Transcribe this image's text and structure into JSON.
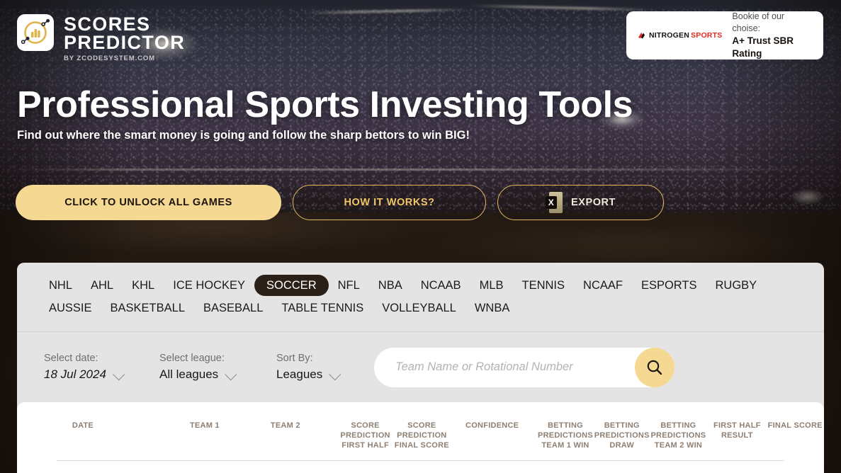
{
  "brand": {
    "line1": "SCORES",
    "line2": "PREDICTOR",
    "tagline": "BY ZCODESYSTEM.COM",
    "logo_icon": "bar-chart-circle-icon",
    "accent": "#f5d892",
    "panel_bg": "#e4e4e4",
    "active_tab_bg": "#2b2018"
  },
  "bookie": {
    "brand_part1": "NITROGEN",
    "brand_part2": "SPORTS",
    "brand_part2_color": "#e8281e",
    "label": "Bookie of our choise:",
    "rating": "A+ Trust SBR Rating"
  },
  "hero": {
    "title": "Professional Sports Investing Tools",
    "subtitle": "Find out where the smart money is going and follow the sharp bettors to win BIG!"
  },
  "cta": {
    "unlock": "CLICK TO UNLOCK ALL GAMES",
    "how_it_works": "HOW IT WORKS?",
    "export": "EXPORT",
    "export_icon": "excel-file-icon",
    "export_icon_letter": "X"
  },
  "tabs": [
    {
      "label": "NHL",
      "active": false
    },
    {
      "label": "AHL",
      "active": false
    },
    {
      "label": "KHL",
      "active": false
    },
    {
      "label": "ICE HOCKEY",
      "active": false
    },
    {
      "label": "SOCCER",
      "active": true
    },
    {
      "label": "NFL",
      "active": false
    },
    {
      "label": "NBA",
      "active": false
    },
    {
      "label": "NCAAB",
      "active": false
    },
    {
      "label": "MLB",
      "active": false
    },
    {
      "label": "TENNIS",
      "active": false
    },
    {
      "label": "NCAAF",
      "active": false
    },
    {
      "label": "ESPORTS",
      "active": false
    },
    {
      "label": "RUGBY",
      "active": false
    },
    {
      "label": "AUSSIE",
      "active": false
    },
    {
      "label": "BASKETBALL",
      "active": false
    },
    {
      "label": "BASEBALL",
      "active": false
    },
    {
      "label": "TABLE TENNIS",
      "active": false
    },
    {
      "label": "VOLLEYBALL",
      "active": false
    },
    {
      "label": "WNBA",
      "active": false
    }
  ],
  "filters": {
    "date": {
      "label": "Select date:",
      "value": "18 Jul 2024"
    },
    "league": {
      "label": "Select league:",
      "value": "All leagues"
    },
    "sort": {
      "label": "Sort By:",
      "value": "Leagues"
    }
  },
  "search": {
    "placeholder": "Team Name or Rotational Number",
    "value": "",
    "icon": "search-icon"
  },
  "table": {
    "columns": [
      "DATE",
      "TEAM 1",
      "TEAM 2",
      "SCORE\nPREDICTION\nFIRST HALF",
      "SCORE\nPREDICTION\nFINAL SCORE",
      "CONFIDENCE",
      "BETTING\nPREDICTIONS\nTEAM 1 WIN",
      "BETTING\nPREDICTIONS\nDRAW",
      "BETTING\nPREDICTIONS\nTEAM 2 WIN",
      "FIRST HALF\nRESULT",
      "FINAL SCORE"
    ],
    "rows": []
  }
}
